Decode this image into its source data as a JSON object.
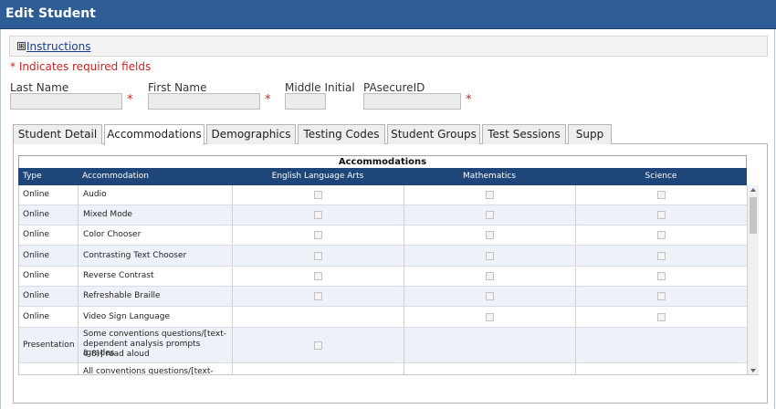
{
  "window": {
    "title": "Edit Student"
  },
  "instructions": {
    "icon": "⊞",
    "label": "Instructions"
  },
  "required_note": "* Indicates required fields",
  "form": {
    "last_name_label": "Last Name",
    "first_name_label": "First Name",
    "middle_initial_label": "Middle Initial",
    "pasecure_label": "PAsecureID",
    "required_star": "*",
    "last_name_value": "",
    "first_name_value": "",
    "middle_initial_value": "",
    "pasecure_value": ""
  },
  "tabs": [
    {
      "label": "Student Detail"
    },
    {
      "label": "Accommodations"
    },
    {
      "label": "Demographics"
    },
    {
      "label": "Testing Codes"
    },
    {
      "label": "Student Groups"
    },
    {
      "label": "Test Sessions"
    },
    {
      "label": "Supp"
    }
  ],
  "active_tab": "Accommodations",
  "table": {
    "title": "Accommodations",
    "columns": [
      "Type",
      "Accommodation",
      "English Language Arts",
      "Mathematics",
      "Science"
    ],
    "rows": [
      {
        "type": "Online",
        "accommodation": "Audio",
        "ela": true,
        "math": true,
        "science": true
      },
      {
        "type": "Online",
        "accommodation": "Mixed Mode",
        "ela": true,
        "math": true,
        "science": true
      },
      {
        "type": "Online",
        "accommodation": "Color Chooser",
        "ela": true,
        "math": true,
        "science": true
      },
      {
        "type": "Online",
        "accommodation": "Contrasting Text Chooser",
        "ela": true,
        "math": true,
        "science": true
      },
      {
        "type": "Online",
        "accommodation": "Reverse Contrast",
        "ela": true,
        "math": true,
        "science": true
      },
      {
        "type": "Online",
        "accommodation": "Refreshable Braille",
        "ela": true,
        "math": true,
        "science": true
      },
      {
        "type": "Online",
        "accommodation": "Video Sign Language",
        "ela": false,
        "math": true,
        "science": true
      },
      {
        "type": "Presentation",
        "accommodation": [
          "Some conventions questions/[text-",
          "dependent analysis prompts (grades",
          "4-8)] read aloud"
        ],
        "ela": true,
        "math": false,
        "science": false
      },
      {
        "type": "",
        "accommodation": [
          "All conventions questions/[text-"
        ],
        "ela": false,
        "math": false,
        "science": false
      }
    ]
  },
  "colors": {
    "titlebar": "#2e5c94",
    "header": "#1f4679",
    "required": "#d32020",
    "link": "#1a3d8f",
    "alt_row": "#eef2f8"
  }
}
